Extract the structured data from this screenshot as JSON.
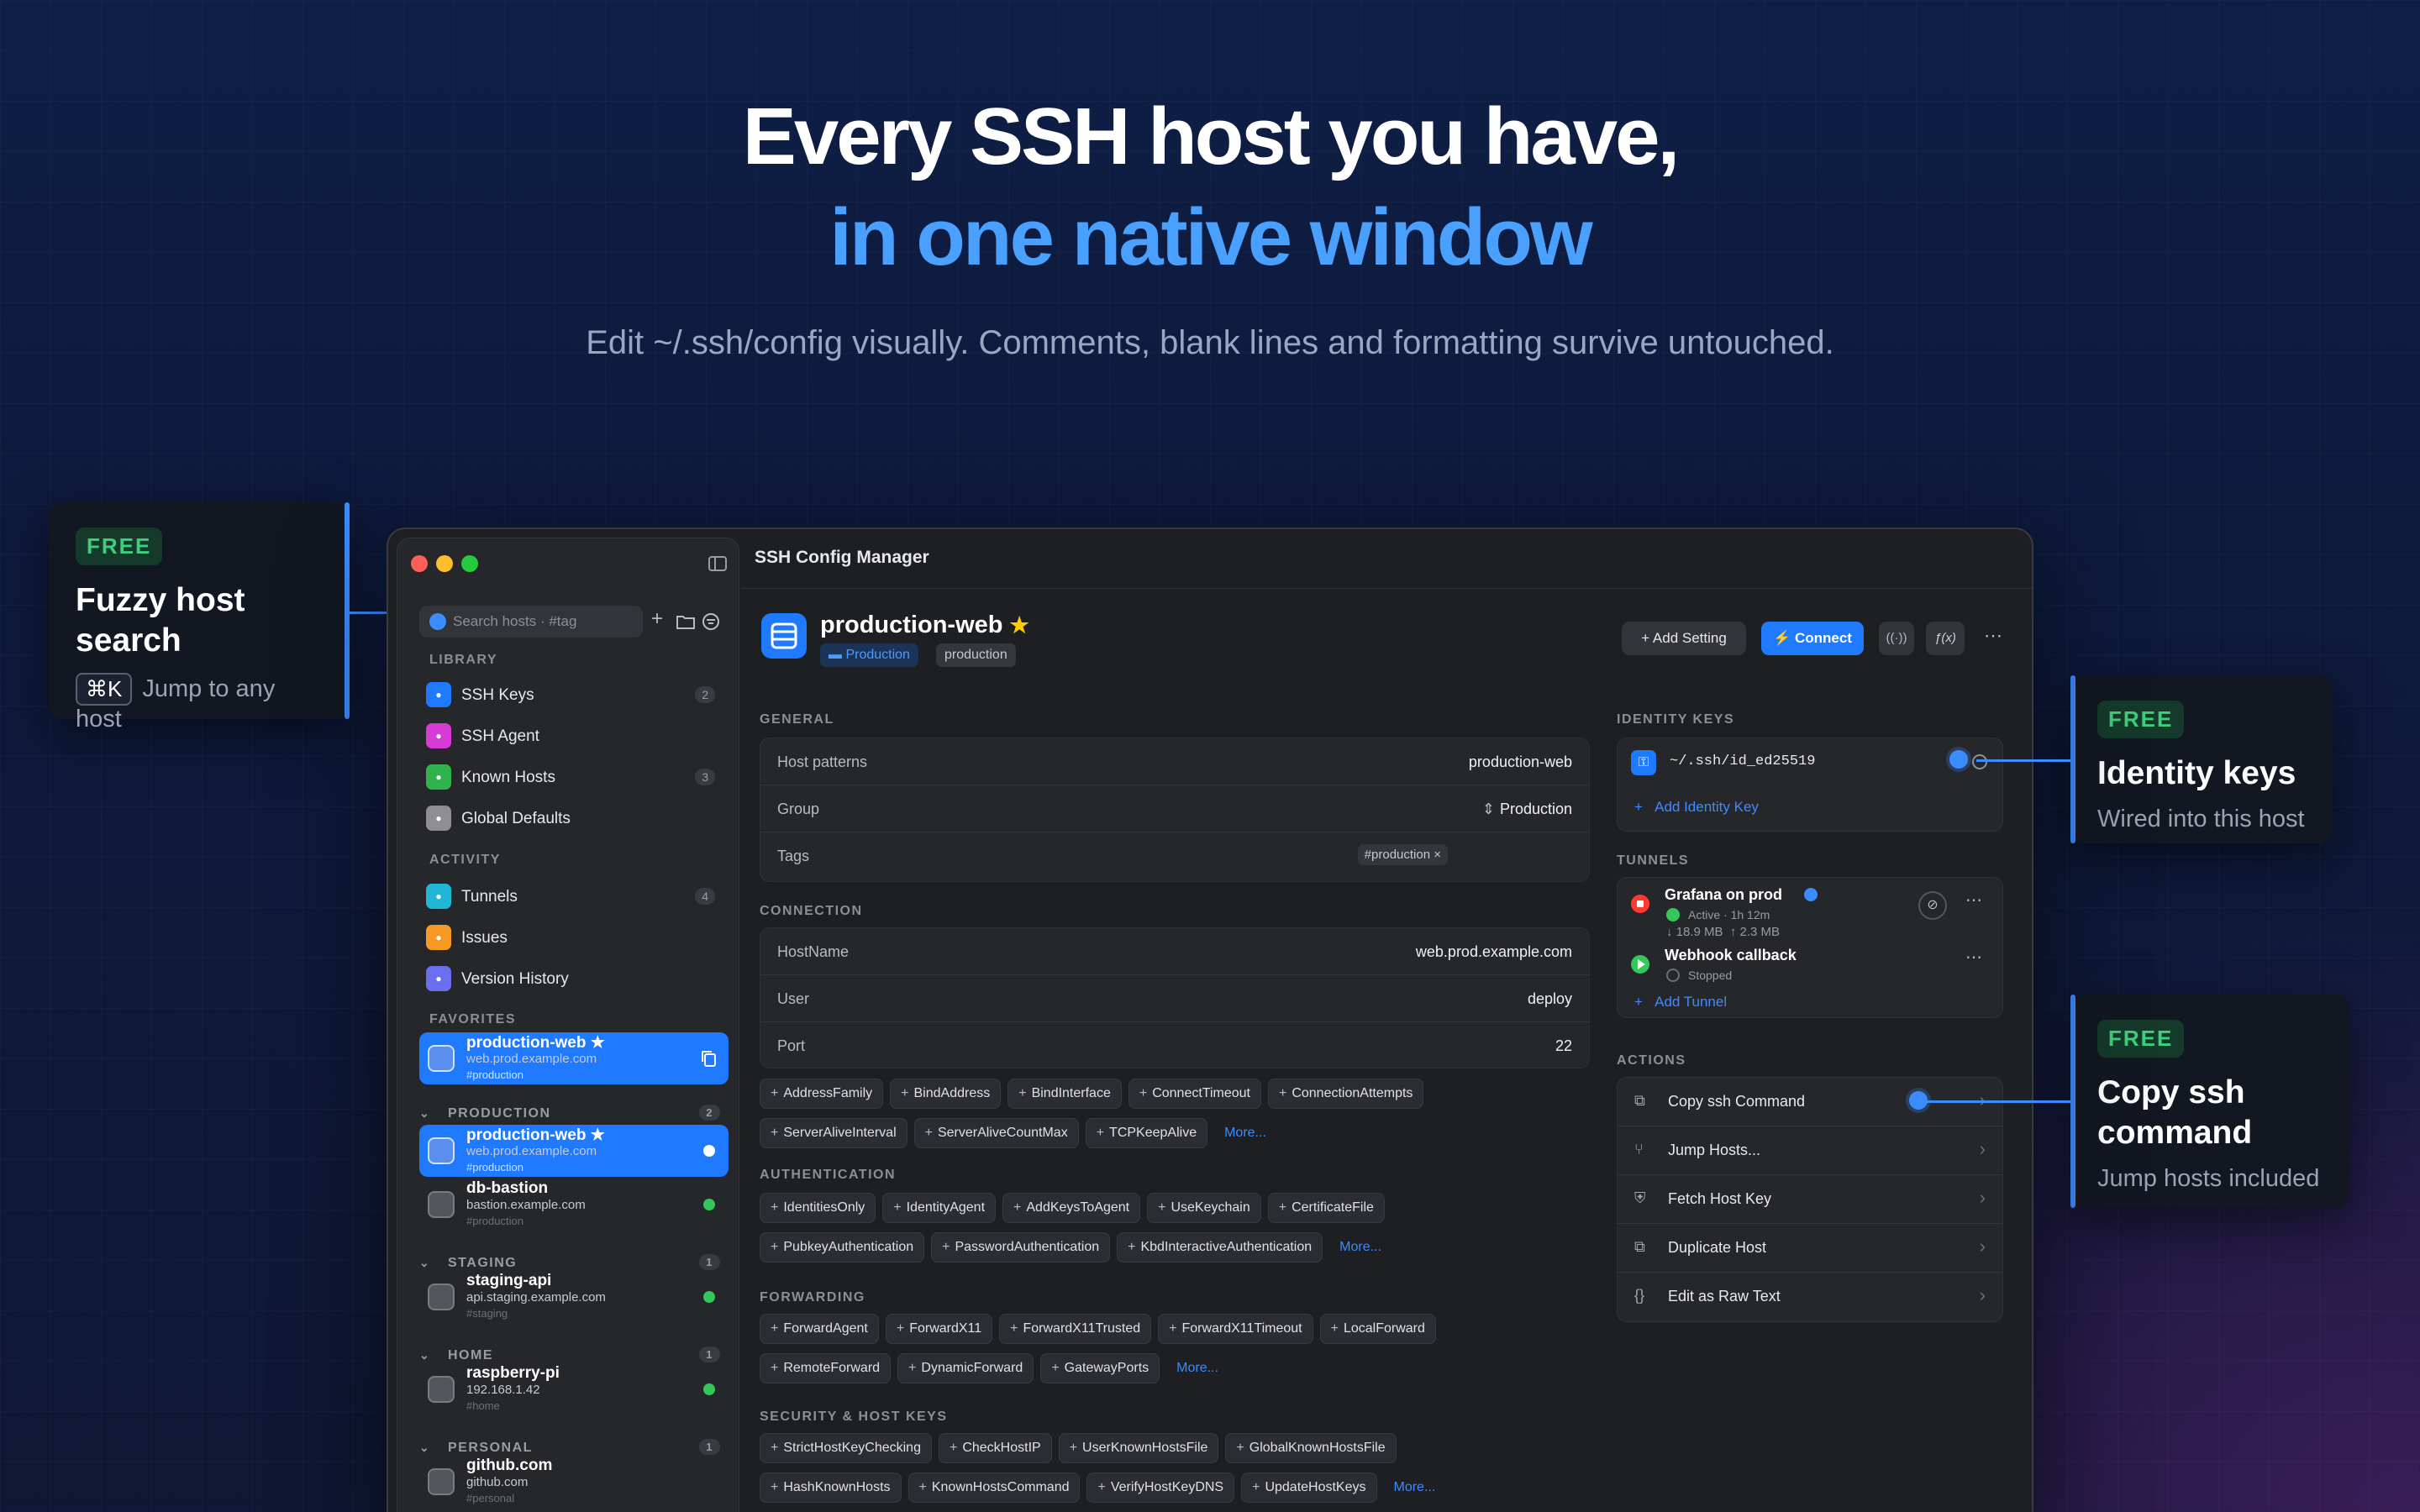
{
  "hero": {
    "line1": "Every SSH host you have,",
    "line2": "in one native window",
    "subtitle": "Edit ~/.ssh/config visually. Comments, blank lines and formatting survive untouched."
  },
  "callouts": {
    "search": {
      "badge": "FREE",
      "title_line1": "Fuzzy host",
      "title_line2": "search",
      "kbd": "⌘K",
      "subtitle": "Jump to any host"
    },
    "identity": {
      "badge": "FREE",
      "title": "Identity keys",
      "subtitle": "Wired into this host"
    },
    "copy": {
      "badge": "FREE",
      "title_line1": "Copy ssh",
      "title_line2": "command",
      "subtitle": "Jump hosts included"
    }
  },
  "app": {
    "title": "SSH Config Manager"
  },
  "sidebar": {
    "search_placeholder": "Search hosts · #tag",
    "library_label": "LIBRARY",
    "library": [
      {
        "label": "SSH Keys",
        "count": "2",
        "icon": "key-icon",
        "color": "#1f7aff"
      },
      {
        "label": "SSH Agent",
        "count": "",
        "icon": "agent-icon",
        "color": "#d73bd6"
      },
      {
        "label": "Known Hosts",
        "count": "3",
        "icon": "shield-icon",
        "color": "#30b34f"
      },
      {
        "label": "Global Defaults",
        "count": "",
        "icon": "asterisk-icon",
        "color": "#8e8e93"
      }
    ],
    "activity_label": "ACTIVITY",
    "activity": [
      {
        "label": "Tunnels",
        "count": "4",
        "icon": "tunnel-icon",
        "color": "#20b6d6"
      },
      {
        "label": "Issues",
        "count": "",
        "icon": "warning-icon",
        "color": "#f59a23"
      },
      {
        "label": "Version History",
        "count": "",
        "icon": "history-icon",
        "color": "#6a6ff0"
      }
    ],
    "favorites_label": "FAVORITES",
    "favorite": {
      "name": "production-web ★",
      "host": "web.prod.example.com",
      "tag": "#production"
    },
    "groups": [
      {
        "name": "PRODUCTION",
        "count": "2",
        "hosts": [
          {
            "name": "production-web ★",
            "host": "web.prod.example.com",
            "tag": "#production"
          },
          {
            "name": "db-bastion",
            "host": "bastion.example.com",
            "tag": "#production"
          }
        ]
      },
      {
        "name": "STAGING",
        "count": "1",
        "hosts": [
          {
            "name": "staging-api",
            "host": "api.staging.example.com",
            "tag": "#staging"
          }
        ]
      },
      {
        "name": "HOME",
        "count": "1",
        "hosts": [
          {
            "name": "raspberry-pi",
            "host": "192.168.1.42",
            "tag": "#home"
          }
        ]
      },
      {
        "name": "PERSONAL",
        "count": "1",
        "hosts": [
          {
            "name": "github.com",
            "host": "github.com",
            "tag": "#personal"
          }
        ]
      }
    ]
  },
  "host": {
    "name": "production-web",
    "star": "★",
    "group_chip": "Production",
    "tag_chip": "production"
  },
  "toolbar": {
    "add_setting": "Add Setting",
    "connect": "Connect"
  },
  "general": {
    "label": "GENERAL",
    "rows": [
      {
        "k": "Host patterns",
        "v": "production-web"
      },
      {
        "k": "Group",
        "v": "Production"
      },
      {
        "k": "Tags",
        "v": "#production ×"
      }
    ]
  },
  "connection": {
    "label": "CONNECTION",
    "rows": [
      {
        "k": "HostName",
        "v": "web.prod.example.com"
      },
      {
        "k": "User",
        "v": "deploy"
      },
      {
        "k": "Port",
        "v": "22"
      }
    ],
    "options": [
      "AddressFamily",
      "BindAddress",
      "BindInterface",
      "ConnectTimeout",
      "ConnectionAttempts",
      "ServerAliveInterval",
      "ServerAliveCountMax",
      "TCPKeepAlive"
    ]
  },
  "authentication": {
    "label": "AUTHENTICATION",
    "options": [
      "IdentitiesOnly",
      "IdentityAgent",
      "AddKeysToAgent",
      "UseKeychain",
      "CertificateFile",
      "PubkeyAuthentication",
      "PasswordAuthentication",
      "KbdInteractiveAuthentication"
    ]
  },
  "forwarding": {
    "label": "FORWARDING",
    "options": [
      "ForwardAgent",
      "ForwardX11",
      "ForwardX11Trusted",
      "ForwardX11Timeout",
      "LocalForward",
      "RemoteForward",
      "DynamicForward",
      "GatewayPorts"
    ]
  },
  "security": {
    "label": "SECURITY & HOST KEYS",
    "options": [
      "StrictHostKeyChecking",
      "CheckHostIP",
      "UserKnownHostsFile",
      "GlobalKnownHostsFile",
      "HashKnownHosts",
      "KnownHostsCommand",
      "VerifyHostKeyDNS",
      "UpdateHostKeys"
    ]
  },
  "more_label": "More...",
  "identity_keys": {
    "label": "IDENTITY KEYS",
    "key": "~/.ssh/id_ed25519",
    "add": "Add Identity Key"
  },
  "tunnels": {
    "label": "TUNNELS",
    "items": [
      {
        "name": "Grafana on prod",
        "status": "Active · 1h 12m",
        "traffic": "↓ 18.9 MB  ↑ 2.3 MB"
      },
      {
        "name": "Webhook callback",
        "status": "Stopped"
      }
    ],
    "add": "Add Tunnel"
  },
  "actions": {
    "label": "ACTIONS",
    "items": [
      {
        "label": "Copy ssh Command",
        "icon": "copy-icon"
      },
      {
        "label": "Jump Hosts...",
        "icon": "jump-icon"
      },
      {
        "label": "Fetch Host Key",
        "icon": "key-icon"
      },
      {
        "label": "Duplicate Host",
        "icon": "duplicate-icon"
      },
      {
        "label": "Edit as Raw Text",
        "icon": "braces-icon"
      }
    ]
  },
  "colors": {
    "accent": "#1f7aff",
    "success": "#34c759",
    "badge_green": "#3ecf7a"
  }
}
